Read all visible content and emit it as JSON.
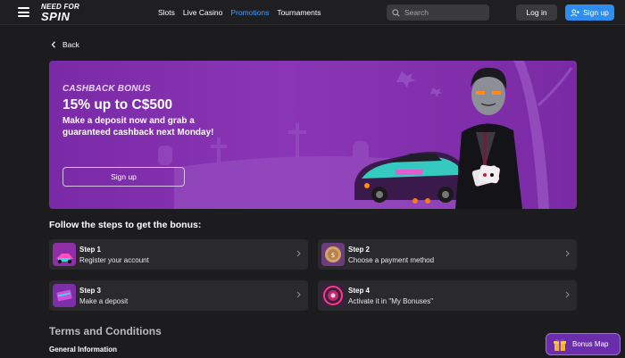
{
  "header": {
    "logo_line1": "NEED FOR",
    "logo_line2": "SPIN",
    "nav": [
      "Slots",
      "Live Casino",
      "Promotions",
      "Tournaments"
    ],
    "active_nav": "Promotions",
    "search_placeholder": "Search",
    "login_label": "Log in",
    "signup_label": "Sign up"
  },
  "back_label": "Back",
  "banner": {
    "label": "CASHBACK BONUS",
    "title": "15% up to C$500",
    "subtitle": "Make a deposit now and grab a guaranteed cashback next Monday!",
    "button_label": "Sign up"
  },
  "steps_heading": "Follow the steps to get the bonus:",
  "steps": [
    {
      "title": "Step 1",
      "desc": "Register your account"
    },
    {
      "title": "Step 2",
      "desc": "Choose a payment method"
    },
    {
      "title": "Step 3",
      "desc": "Make a deposit"
    },
    {
      "title": "Step 4",
      "desc": "Activate it in \"My Bonuses\""
    }
  ],
  "terms_heading": "Terms and Conditions",
  "general_info": "General Information",
  "bonus_map_label": "Bonus Map",
  "colors": {
    "background": "#1c1c1e",
    "accent_blue": "#2e8ef0",
    "banner_purple": "#8a35b5",
    "card": "#2a2a2e"
  }
}
